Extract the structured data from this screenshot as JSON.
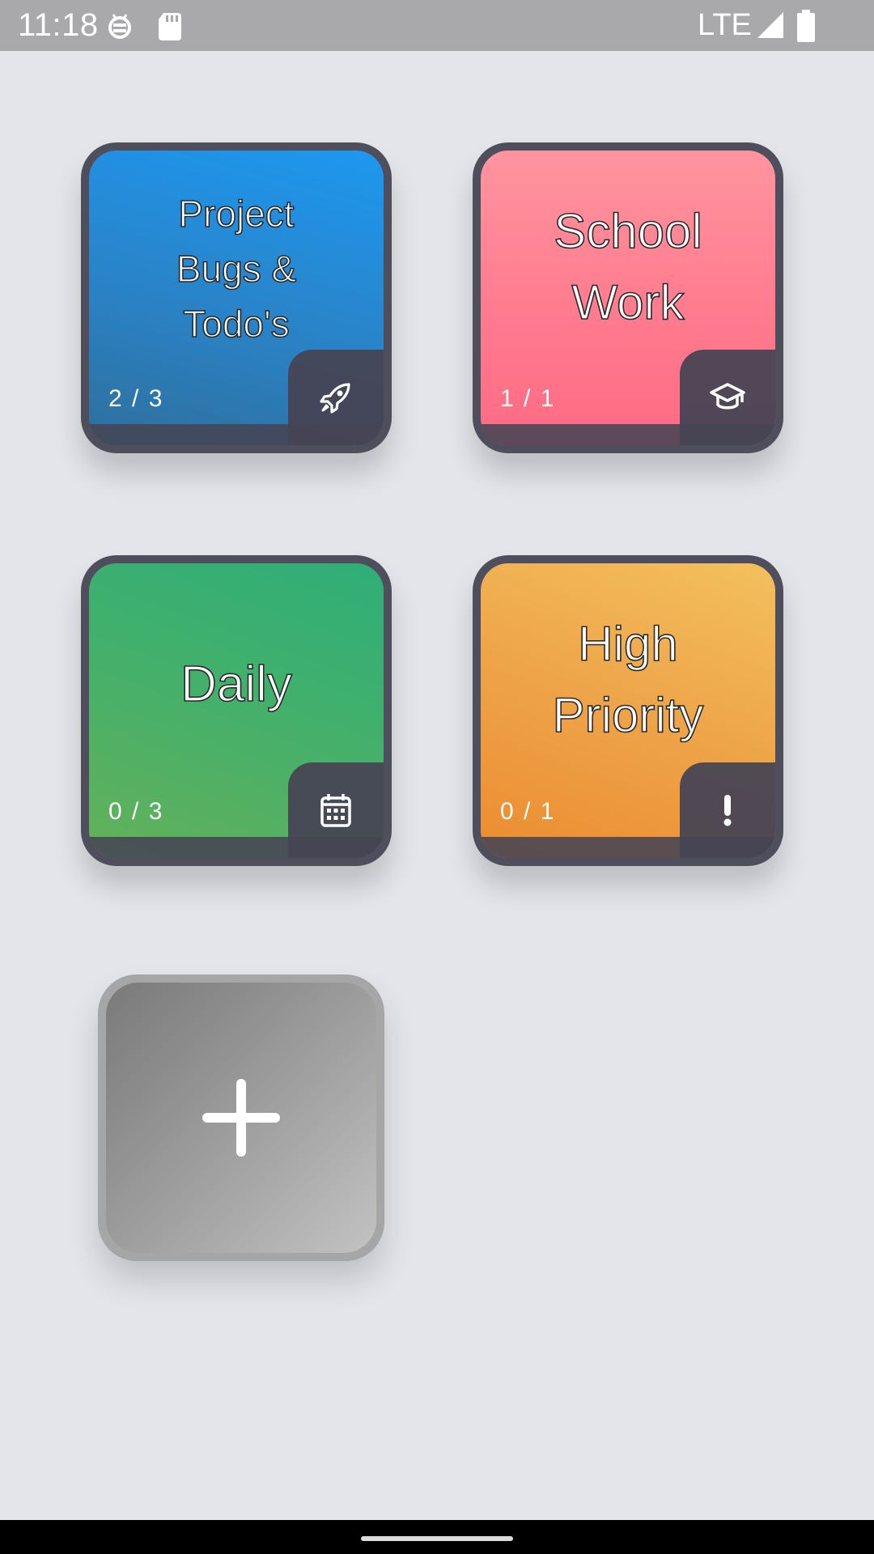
{
  "status_bar": {
    "time": "11:18",
    "network": "LTE"
  },
  "tiles": [
    {
      "title": "Project\nBugs &\nTodo's",
      "count": "2 / 3",
      "icon": "rocket-icon",
      "gradient": [
        "#1d98f0",
        "#2f6f9d"
      ]
    },
    {
      "title": "School\nWork",
      "count": "1 / 1",
      "icon": "graduation-cap-icon",
      "gradient": [
        "#ff909c",
        "#ff6a84"
      ]
    },
    {
      "title": "Daily",
      "count": "0 / 3",
      "icon": "calendar-icon",
      "gradient": [
        "#2fae78",
        "#64b15a"
      ]
    },
    {
      "title": "High\nPriority",
      "count": "0 / 1",
      "icon": "exclamation-icon",
      "gradient": [
        "#f3c05d",
        "#ec8c30"
      ]
    }
  ],
  "add_button": {
    "icon": "plus-icon"
  }
}
